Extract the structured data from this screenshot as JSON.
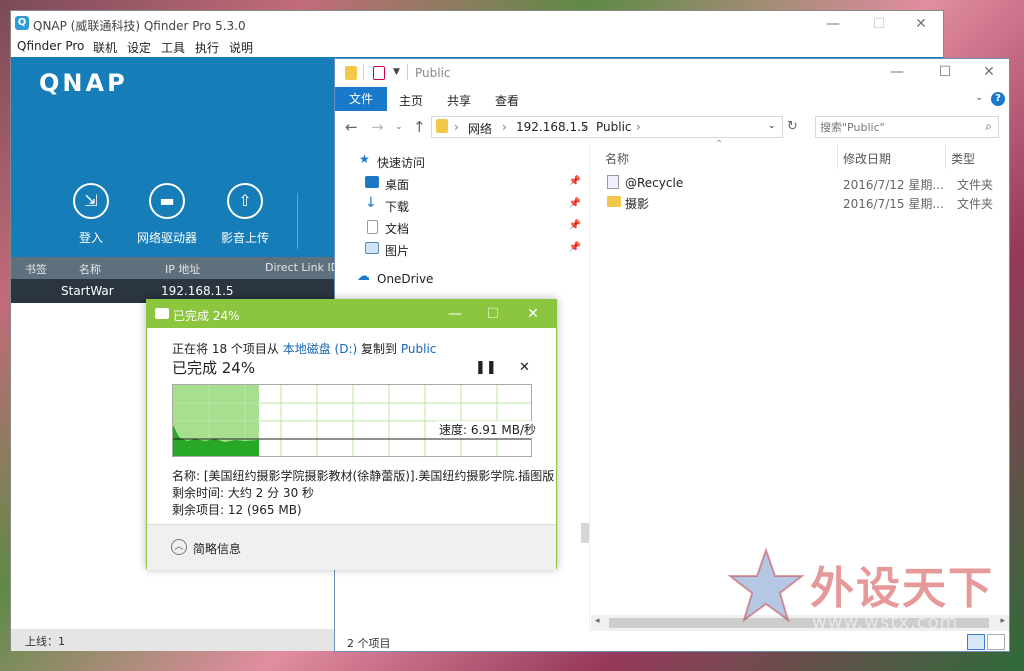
{
  "qfinder": {
    "title": "QNAP (威联通科技) Qfinder Pro 5.3.0",
    "logo_text": "QNAP",
    "menu": [
      "Qfinder Pro",
      "联机",
      "设定",
      "工具",
      "执行",
      "说明"
    ],
    "tools": [
      {
        "label": "登入",
        "icon": "login-icon"
      },
      {
        "label": "网络驱动器",
        "icon": "folder-icon"
      },
      {
        "label": "影音上传",
        "icon": "upload-icon"
      }
    ],
    "columns": [
      "书签",
      "名称",
      "IP 地址",
      "Direct Link ID"
    ],
    "devices": [
      {
        "name": "StartWar",
        "ip": "192.168.1.5"
      }
    ],
    "status": "上线：1"
  },
  "explorer": {
    "title": "Public",
    "ribbon_tabs": [
      "文件",
      "主页",
      "共享",
      "查看"
    ],
    "breadcrumb": [
      "网络",
      "192.168.1.5",
      "Public"
    ],
    "search_placeholder": "搜索\"Public\"",
    "nav": {
      "quick_access": "快速访问",
      "items": [
        "桌面",
        "下载",
        "文档",
        "图片"
      ],
      "onedrive": "OneDrive"
    },
    "columns": [
      "名称",
      "修改日期",
      "类型"
    ],
    "files": [
      {
        "name": "@Recycle",
        "date": "2016/7/12 星期...",
        "type": "文件夹"
      },
      {
        "name": "摄影",
        "date": "2016/7/15 星期...",
        "type": "文件夹"
      }
    ],
    "status": "2 个项目"
  },
  "copy": {
    "title": "已完成 24%",
    "from_prefix": "正在将 18 个项目从",
    "source": "本地磁盘 (D:)",
    "to_word": "复制到",
    "dest": "Public",
    "percent_text": "已完成 24%",
    "progress": 0.24,
    "speed": "速度: 6.91 MB/秒",
    "name_line": "名称: [美国纽约摄影学院摄影教材(徐静蕾版)].美国纽约摄影学院.插图版",
    "time_line": "剩余时间: 大约 2 分 30 秒",
    "items_line": "剩余项目: 12 (965 MB)",
    "details": "简略信息",
    "accent": "#8cc63e"
  },
  "watermark": {
    "text": "外设天下",
    "url": "www.wstx.com"
  }
}
